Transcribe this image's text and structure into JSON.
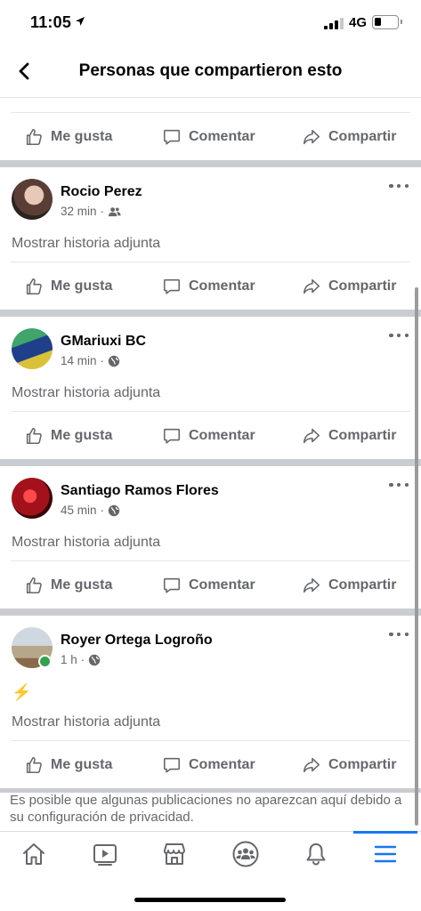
{
  "status": {
    "time": "11:05",
    "network": "4G"
  },
  "header": {
    "title": "Personas que compartieron esto"
  },
  "actions": {
    "like": "Me gusta",
    "comment": "Comentar",
    "share": "Compartir"
  },
  "posts": [
    {
      "name": "Rocio Perez",
      "time": "32 min",
      "audience_icon": "friends-icon",
      "story": "Mostrar historia adjunta",
      "avatar_color": "#6b5a55"
    },
    {
      "name": "GMariuxi BC",
      "time": "14 min",
      "audience_icon": "globe-icon",
      "story": "Mostrar historia adjunta",
      "avatar_color": "#2a7a6a"
    },
    {
      "name": "Santiago Ramos Flores",
      "time": "45 min",
      "audience_icon": "globe-icon",
      "story": "Mostrar historia adjunta",
      "avatar_color": "#a3121c"
    },
    {
      "name": "Royer Ortega Logroño",
      "time": "1 h",
      "audience_icon": "globe-icon",
      "emoji": "⚡",
      "story": "Mostrar historia adjunta",
      "avatar_color": "#b7a78a",
      "online": true
    }
  ],
  "footer": {
    "privacy_note": "Es posible que algunas publicaciones no aparezcan aquí debido a su configuración de privacidad."
  },
  "tabs": [
    "home-icon",
    "video-icon",
    "marketplace-icon",
    "groups-icon",
    "notifications-icon",
    "menu-icon"
  ],
  "colors": {
    "accent": "#1877f2",
    "secondary_text": "#65676b",
    "separator": "#c9ccd1"
  }
}
